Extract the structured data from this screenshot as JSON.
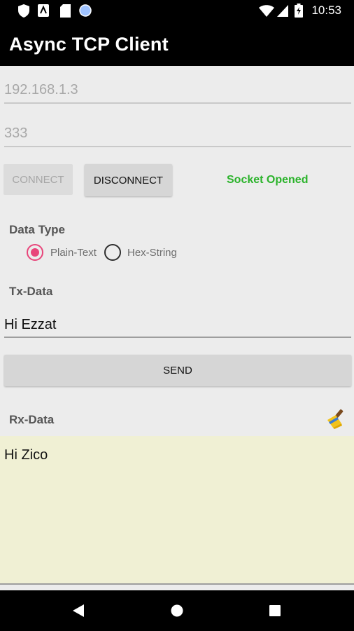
{
  "status_bar": {
    "time": "10:53",
    "icons": [
      "shield-icon",
      "photos-icon",
      "sd-card-icon",
      "circle-icon",
      "wifi-icon",
      "signal-icon",
      "battery-icon"
    ]
  },
  "app": {
    "title": "Async TCP Client"
  },
  "connection": {
    "ip": "192.168.1.3",
    "port": "333",
    "connect_label": "CONNECT",
    "disconnect_label": "DISCONNECT",
    "status": "Socket Opened",
    "status_color": "#2bb32b"
  },
  "data_type": {
    "label": "Data Type",
    "options": [
      "Plain-Text",
      "Hex-String"
    ],
    "selected": "Plain-Text",
    "accent": "#e8457a"
  },
  "tx": {
    "label": "Tx-Data",
    "value": "Hi Ezzat",
    "send_label": "SEND"
  },
  "rx": {
    "label": "Rx-Data",
    "value": "Hi Zico",
    "clear_icon": "broom-icon",
    "background": "#f0f0d4"
  },
  "nav_bar": {
    "icons": [
      "back-icon",
      "home-icon",
      "recents-icon"
    ]
  }
}
